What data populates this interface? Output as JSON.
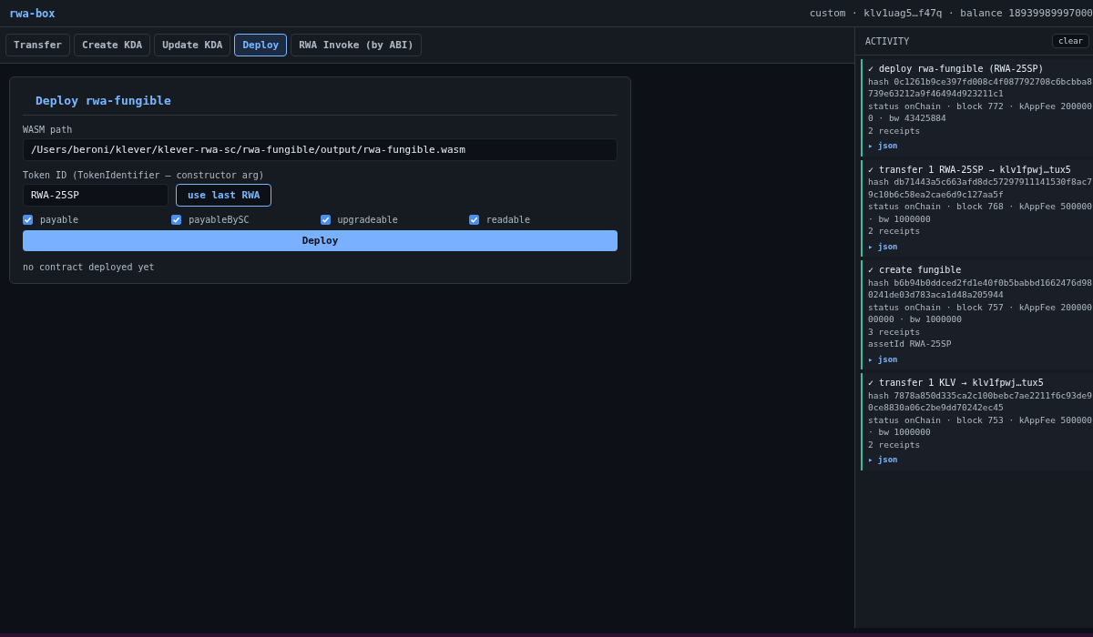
{
  "app": {
    "title": "rwa-box",
    "account": "custom · klv1uag5…f47q · balance 18939989997000"
  },
  "tabs": [
    {
      "label": "Transfer",
      "selected": false
    },
    {
      "label": "Create KDA",
      "selected": false
    },
    {
      "label": "Update KDA",
      "selected": false
    },
    {
      "label": "Deploy",
      "selected": true
    },
    {
      "label": "RWA Invoke (by ABI)",
      "selected": false
    }
  ],
  "deploy_card": {
    "title": "Deploy rwa-fungible",
    "wasm_label": "WASM path",
    "wasm_value": "/Users/beroni/klever/klever-rwa-sc/rwa-fungible/output/rwa-fungible.wasm",
    "token_label": "Token ID (TokenIdentifier — constructor arg)",
    "token_value": "RWA-25SP",
    "use_last_button": "use last RWA",
    "options": [
      {
        "label": "payable",
        "checked": true
      },
      {
        "label": "payableBySC",
        "checked": true
      },
      {
        "label": "upgradeable",
        "checked": true
      },
      {
        "label": "readable",
        "checked": true
      }
    ],
    "deploy_button": "Deploy",
    "status": "no contract deployed yet"
  },
  "activity": {
    "title": "ACTIVITY",
    "clear_button": "clear",
    "entries": [
      {
        "title": "✓ deploy rwa-fungible (RWA-25SP)",
        "lines": [
          "hash 0c1261b9ce397fd008c4f087792708c6bcbba8739e63212a9f46494d923211c1",
          "status onChain · block 772 · kAppFee 2000000 · bw 43425884",
          "2 receipts"
        ],
        "json": "▸ json"
      },
      {
        "title": "✓ transfer 1 RWA-25SP → klv1fpwj…tux5",
        "lines": [
          "hash db71443a5c663afd8dc57297911141530f8ac79c10b6c58ea2cae6d9c127aa5f",
          "status onChain · block 768 · kAppFee 500000 · bw 1000000",
          "2 receipts"
        ],
        "json": "▸ json"
      },
      {
        "title": "✓ create fungible",
        "lines": [
          "hash b6b94b0ddced2fd1e40f0b5babbd1662476d980241de03d783aca1d48a205944",
          "status onChain · block 757 · kAppFee 20000000000 · bw 1000000",
          "3 receipts",
          "assetId RWA-25SP"
        ],
        "json": "▸ json"
      },
      {
        "title": "✓ transfer 1 KLV → klv1fpwj…tux5",
        "lines": [
          "hash 7878a850d335ca2c100bebc7ae2211f6c93de90ce8830a06c2be9dd70242ec45",
          "status onChain · block 753 · kAppFee 500000 · bw 1000000",
          "2 receipts"
        ],
        "json": "▸ json"
      }
    ]
  }
}
